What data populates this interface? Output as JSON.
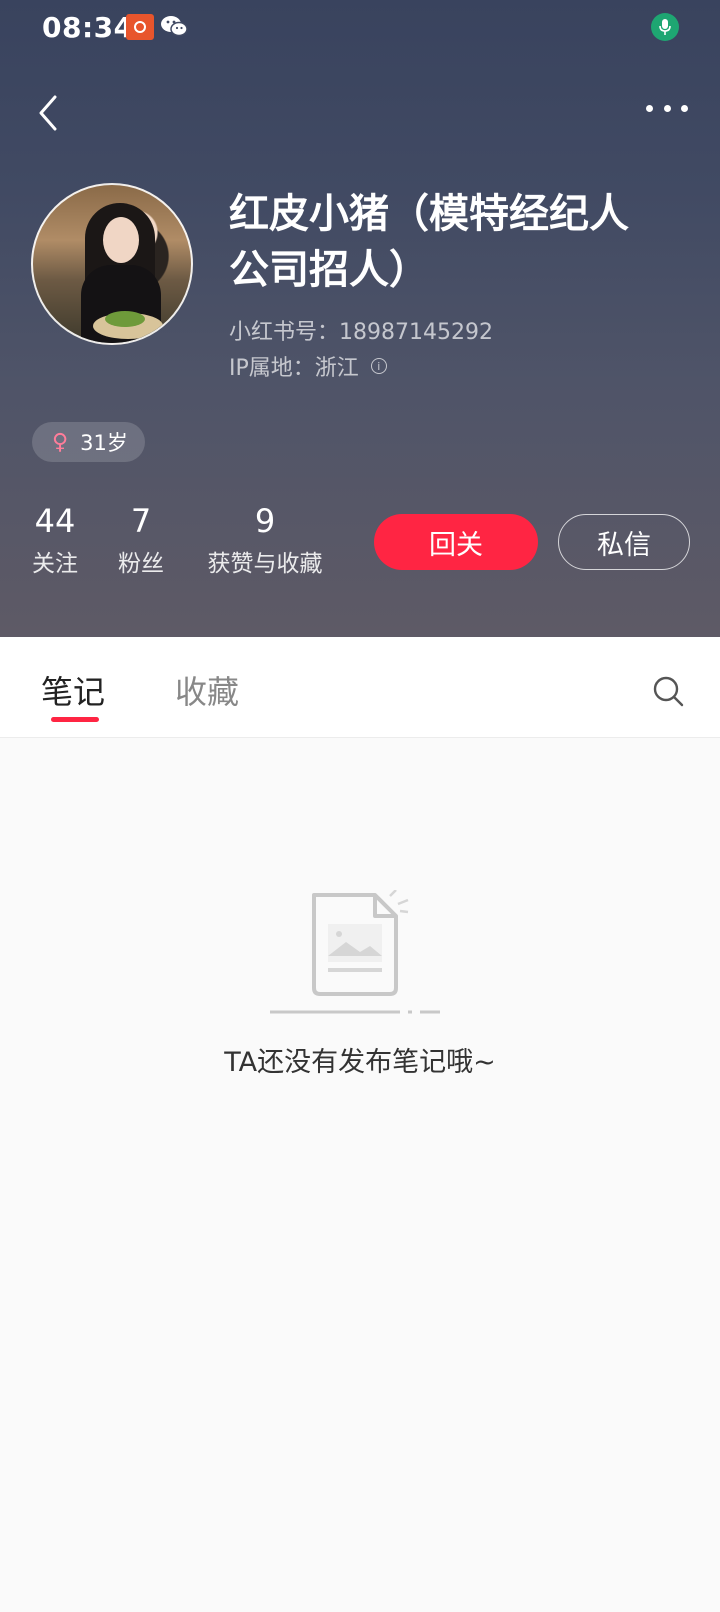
{
  "status_bar": {
    "time": "08:34",
    "icons": [
      "app-notification-icon",
      "wechat-icon",
      "microphone-icon"
    ]
  },
  "header": {
    "icons": [
      "back-arrow-icon",
      "more-dots-icon"
    ]
  },
  "profile": {
    "username": "红皮小猪（模特经纪人公司招人）",
    "xhs_id": "小红书号：18987145292",
    "ip_location": "IP属地：浙江",
    "age": "31岁",
    "gender_icon": "female-icon"
  },
  "stats": {
    "following": {
      "value": "44",
      "label": "关注"
    },
    "followers": {
      "value": "7",
      "label": "粉丝"
    },
    "likes": {
      "value": "9",
      "label": "获赞与收藏"
    }
  },
  "actions": {
    "follow_back_label": "回关",
    "message_label": "私信"
  },
  "tabs": [
    {
      "label": "笔记",
      "active": true
    },
    {
      "label": "收藏",
      "active": false
    }
  ],
  "empty_state": {
    "message": "TA还没有发布笔记哦~"
  },
  "colors": {
    "accent": "#ff2543",
    "female": "#ff7d9a",
    "mic_green": "#1ea672"
  }
}
